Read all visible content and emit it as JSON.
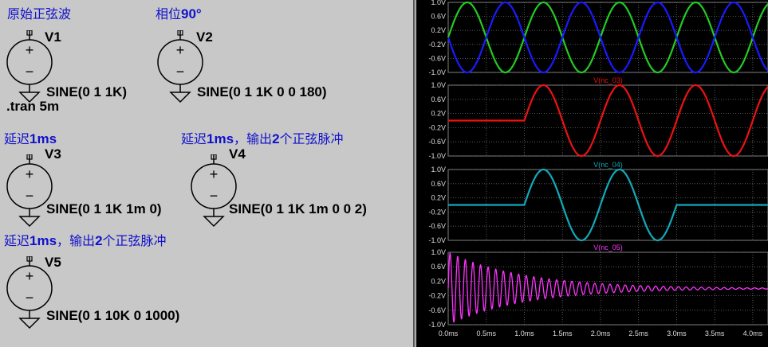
{
  "schematic": {
    "blocks": [
      {
        "title_cn": "原始正弦波",
        "title_en": "",
        "title_cn2": "",
        "title_en2": "",
        "title_cn3": "",
        "name": "V1",
        "spec": "SINE(0 1 1K)"
      },
      {
        "title_cn": "相位",
        "title_en": "90°",
        "title_cn2": "",
        "title_en2": "",
        "title_cn3": "",
        "name": "V2",
        "spec": "SINE(0 1 1K 0 0 180)"
      },
      {
        "title_cn": "延迟",
        "title_en": "1ms",
        "title_cn2": "",
        "title_en2": "",
        "title_cn3": "",
        "name": "V3",
        "spec": "SINE(0 1 1K 1m 0)"
      },
      {
        "title_cn": "延迟",
        "title_en": "1ms",
        "title_cn2": "，输出",
        "title_en2": "2",
        "title_cn3": "个正弦脉冲",
        "name": "V4",
        "spec": "SINE(0 1 1K 1m 0 0 2)"
      },
      {
        "title_cn": "延迟",
        "title_en": "1ms",
        "title_cn2": "，输出",
        "title_en2": "2",
        "title_cn3": "个正弦脉冲",
        "name": "V5",
        "spec": "SINE(0 1 10K 0 1000)"
      }
    ],
    "directive": ".tran 5m",
    "symbol_plus": "+",
    "symbol_minus": "−"
  },
  "chart_data": [
    {
      "type": "line",
      "title": "",
      "xlim": [
        0,
        4.2
      ],
      "ylim": [
        -1.0,
        1.0
      ],
      "yticks": [
        "1.0V",
        "0.6V",
        "0.2V",
        "-0.2V",
        "-0.6V",
        "-1.0V"
      ],
      "series": [
        {
          "name": "",
          "color": "#22cc22",
          "freq_khz": 1,
          "amplitude": 1,
          "delay_ms": 0,
          "phase_deg": 0,
          "damping": 0,
          "cycles": 0
        },
        {
          "name": "",
          "color": "#1a1aff",
          "freq_khz": 1,
          "amplitude": 1,
          "delay_ms": 0,
          "phase_deg": 180,
          "damping": 0,
          "cycles": 0
        }
      ]
    },
    {
      "type": "line",
      "title": "V(nc_03)",
      "xlim": [
        0,
        4.2
      ],
      "ylim": [
        -1.0,
        1.0
      ],
      "yticks": [
        "1.0V",
        "0.6V",
        "0.2V",
        "-0.2V",
        "-0.6V",
        "-1.0V"
      ],
      "series": [
        {
          "name": "V(nc_03)",
          "color": "#ee1111",
          "freq_khz": 1,
          "amplitude": 1,
          "delay_ms": 1,
          "phase_deg": 0,
          "damping": 0,
          "cycles": 0
        }
      ]
    },
    {
      "type": "line",
      "title": "V(nc_04)",
      "xlim": [
        0,
        4.2
      ],
      "ylim": [
        -1.0,
        1.0
      ],
      "yticks": [
        "1.0V",
        "0.6V",
        "0.2V",
        "-0.2V",
        "-0.6V",
        "-1.0V"
      ],
      "series": [
        {
          "name": "V(nc_04)",
          "color": "#11aabb",
          "freq_khz": 1,
          "amplitude": 1,
          "delay_ms": 1,
          "phase_deg": 0,
          "damping": 0,
          "cycles": 2
        }
      ]
    },
    {
      "type": "line",
      "title": "V(nc_05)",
      "xlim": [
        0,
        4.2
      ],
      "ylim": [
        -1.0,
        1.0
      ],
      "yticks": [
        "1.0V",
        "0.6V",
        "0.2V",
        "-0.2V",
        "-0.6V",
        "-1.0V"
      ],
      "xticks": [
        "0.0ms",
        "0.5ms",
        "1.0ms",
        "1.5ms",
        "2.0ms",
        "2.5ms",
        "3.0ms",
        "3.5ms",
        "4.0ms"
      ],
      "xtick_values": [
        0,
        0.5,
        1.0,
        1.5,
        2.0,
        2.5,
        3.0,
        3.5,
        4.0
      ],
      "series": [
        {
          "name": "V(nc_05)",
          "color": "#ff33ff",
          "freq_khz": 10,
          "amplitude": 1,
          "delay_ms": 0,
          "phase_deg": 0,
          "damping": 1000,
          "cycles": 0
        }
      ]
    }
  ]
}
